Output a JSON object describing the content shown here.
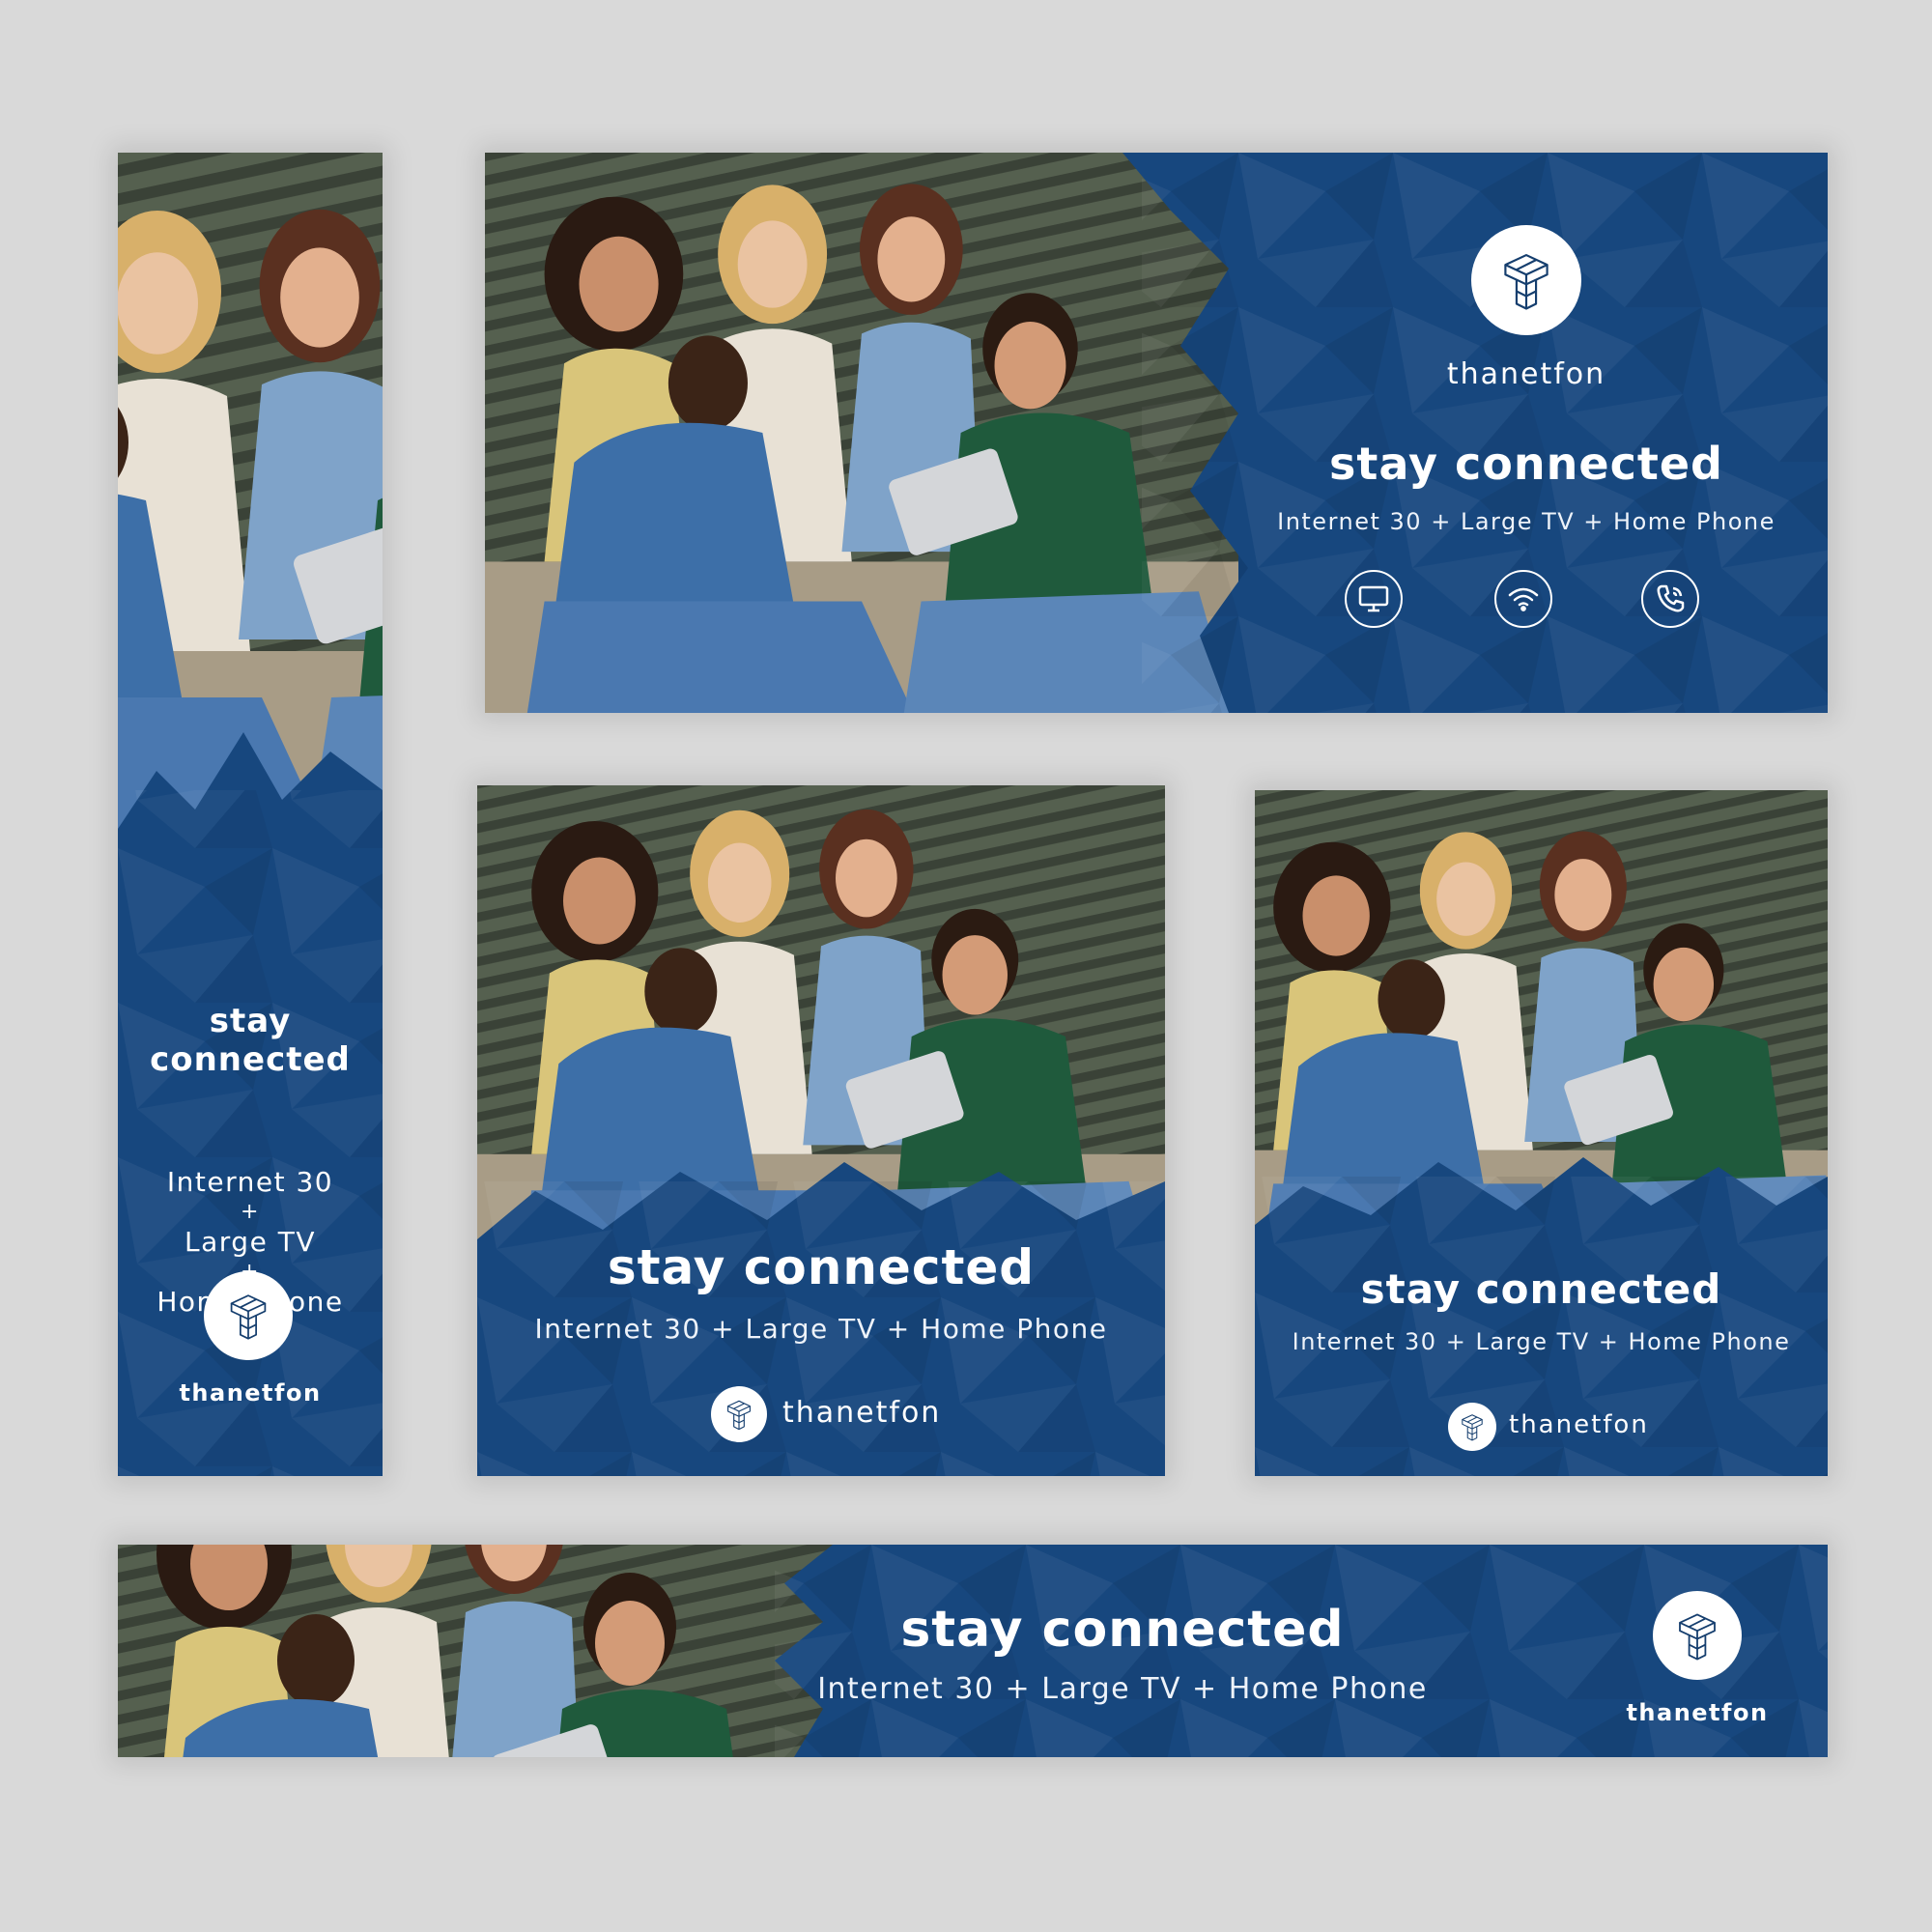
{
  "brand": {
    "name": "thanetfon"
  },
  "tagline": "stay connected",
  "tagline_words": [
    "stay",
    "connected"
  ],
  "package": "Internet 30 + Large TV + Home Phone",
  "package_parts": [
    "Internet 30",
    "+",
    "Large TV",
    "+",
    "Home Phone"
  ],
  "icons": [
    "tv-icon",
    "wifi-icon",
    "phone-icon"
  ],
  "colors": {
    "background": "#d9d9d9",
    "brand_blue_dark": "#0f2f5a",
    "brand_blue": "#1f5a96",
    "text": "#ffffff"
  }
}
